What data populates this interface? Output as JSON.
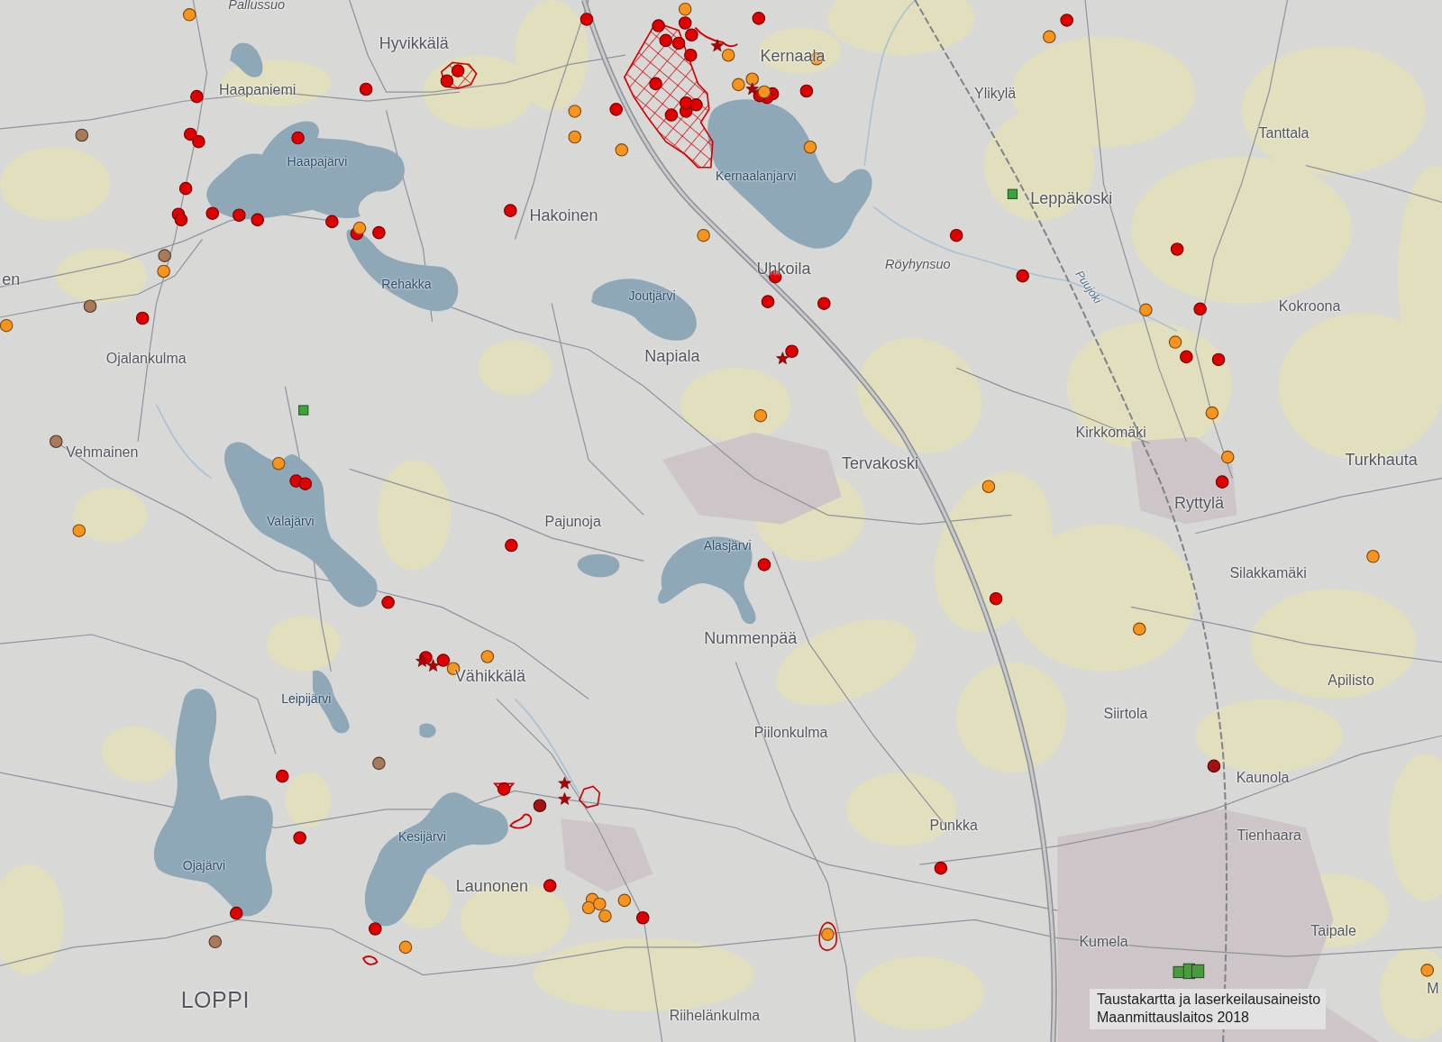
{
  "place_names": [
    {
      "text": "Pallussuo",
      "kind": "swamp"
    },
    {
      "text": "Hyvikkälä",
      "kind": "village"
    },
    {
      "text": "Haapaniemi",
      "kind": "hamlet"
    },
    {
      "text": "Kernaala",
      "kind": "village"
    },
    {
      "text": "Ylikylä",
      "kind": "hamlet"
    },
    {
      "text": "Tanttala",
      "kind": "hamlet"
    },
    {
      "text": "Haapajärvi",
      "kind": "lake"
    },
    {
      "text": "Kernaalanjärvi",
      "kind": "lake"
    },
    {
      "text": "Leppäkoski",
      "kind": "village"
    },
    {
      "text": "Hakoinen",
      "kind": "village"
    },
    {
      "text": "Röyhynsuo",
      "kind": "swamp"
    },
    {
      "text": "Uhkoila",
      "kind": "village"
    },
    {
      "text": "en",
      "kind": "village"
    },
    {
      "text": "Rehakka",
      "kind": "lake"
    },
    {
      "text": "Puujoki",
      "kind": "river"
    },
    {
      "text": "Joutjärvi",
      "kind": "lake"
    },
    {
      "text": "Kokroona",
      "kind": "hamlet"
    },
    {
      "text": "Napiala",
      "kind": "village"
    },
    {
      "text": "Ojalankulma",
      "kind": "hamlet"
    },
    {
      "text": "Kirkkomäki",
      "kind": "hamlet"
    },
    {
      "text": "Vehmainen",
      "kind": "hamlet"
    },
    {
      "text": "Tervakoski",
      "kind": "village"
    },
    {
      "text": "Turkhauta",
      "kind": "village"
    },
    {
      "text": "Ryttylä",
      "kind": "village"
    },
    {
      "text": "Pajunoja",
      "kind": "hamlet"
    },
    {
      "text": "Valajärvi",
      "kind": "lake"
    },
    {
      "text": "Alasjärvi",
      "kind": "lake"
    },
    {
      "text": "Silakkamäki",
      "kind": "hamlet"
    },
    {
      "text": "Nummenpää",
      "kind": "village"
    },
    {
      "text": "Vähikkälä",
      "kind": "village"
    },
    {
      "text": "Apilisto",
      "kind": "hamlet"
    },
    {
      "text": "Leipijärvi",
      "kind": "lake"
    },
    {
      "text": "Siirtola",
      "kind": "hamlet"
    },
    {
      "text": "Piilonkulma",
      "kind": "hamlet"
    },
    {
      "text": "Kaunola",
      "kind": "hamlet"
    },
    {
      "text": "Punkka",
      "kind": "hamlet"
    },
    {
      "text": "Tienhaara",
      "kind": "hamlet"
    },
    {
      "text": "Kesijärvi",
      "kind": "lake"
    },
    {
      "text": "Ojajärvi",
      "kind": "lake"
    },
    {
      "text": "Launonen",
      "kind": "village"
    },
    {
      "text": "Taipale",
      "kind": "hamlet"
    },
    {
      "text": "Kumela",
      "kind": "hamlet"
    },
    {
      "text": "M",
      "kind": "hamlet"
    },
    {
      "text": "LOPPI",
      "kind": "municipality"
    },
    {
      "text": "Riihelänkulma",
      "kind": "hamlet"
    }
  ],
  "markers": [
    {
      "kind": "dot",
      "color": "#e00000"
    },
    {
      "kind": "dot",
      "color": "#e00000"
    },
    {
      "kind": "dot",
      "color": "#e00000"
    },
    {
      "kind": "dot",
      "color": "#e00000"
    },
    {
      "kind": "dot",
      "color": "#e00000"
    },
    {
      "kind": "dot",
      "color": "#e00000"
    },
    {
      "kind": "dot",
      "color": "#e00000"
    },
    {
      "kind": "dot",
      "color": "#e00000"
    },
    {
      "kind": "dot",
      "color": "#e00000"
    },
    {
      "kind": "dot",
      "color": "#e00000"
    },
    {
      "kind": "dot",
      "color": "#e00000"
    },
    {
      "kind": "dot",
      "color": "#e00000"
    },
    {
      "kind": "dot",
      "color": "#e00000"
    },
    {
      "kind": "dot",
      "color": "#e00000"
    },
    {
      "kind": "dot",
      "color": "#e00000"
    },
    {
      "kind": "dot",
      "color": "#e00000"
    },
    {
      "kind": "dot",
      "color": "#e00000"
    },
    {
      "kind": "dot",
      "color": "#e00000"
    },
    {
      "kind": "dot",
      "color": "#e00000"
    },
    {
      "kind": "dot",
      "color": "#e00000"
    },
    {
      "kind": "dot",
      "color": "#e00000"
    },
    {
      "kind": "dot",
      "color": "#e00000"
    },
    {
      "kind": "dot",
      "color": "#e00000"
    },
    {
      "kind": "dot",
      "color": "#e00000"
    },
    {
      "kind": "dot",
      "color": "#e00000"
    },
    {
      "kind": "dot",
      "color": "#e00000"
    },
    {
      "kind": "dot",
      "color": "#e00000"
    },
    {
      "kind": "dot",
      "color": "#e00000"
    },
    {
      "kind": "dot",
      "color": "#e00000"
    },
    {
      "kind": "dot",
      "color": "#e00000"
    },
    {
      "kind": "dot",
      "color": "#e00000"
    },
    {
      "kind": "dot",
      "color": "#e00000"
    },
    {
      "kind": "dot",
      "color": "#e00000"
    },
    {
      "kind": "dot",
      "color": "#e00000"
    },
    {
      "kind": "dot",
      "color": "#e00000"
    },
    {
      "kind": "dot",
      "color": "#e00000"
    },
    {
      "kind": "dot",
      "color": "#e00000"
    },
    {
      "kind": "dot",
      "color": "#e00000"
    },
    {
      "kind": "dot",
      "color": "#e00000"
    },
    {
      "kind": "dot",
      "color": "#e00000"
    },
    {
      "kind": "dot",
      "color": "#e00000"
    },
    {
      "kind": "dot",
      "color": "#e00000"
    },
    {
      "kind": "dot",
      "color": "#e00000"
    },
    {
      "kind": "dot",
      "color": "#e00000"
    },
    {
      "kind": "dot",
      "color": "#e00000"
    },
    {
      "kind": "dot",
      "color": "#e00000"
    },
    {
      "kind": "dot",
      "color": "#e00000"
    },
    {
      "kind": "dot",
      "color": "#e00000"
    },
    {
      "kind": "dot",
      "color": "#e00000"
    },
    {
      "kind": "dot",
      "color": "#e00000"
    },
    {
      "kind": "dot",
      "color": "#e00000"
    },
    {
      "kind": "dot",
      "color": "#e00000"
    },
    {
      "kind": "dot",
      "color": "#e00000"
    },
    {
      "kind": "dot",
      "color": "#e00000"
    },
    {
      "kind": "dot",
      "color": "#e00000"
    },
    {
      "kind": "dot",
      "color": "#e00000"
    },
    {
      "kind": "dot",
      "color": "#e00000"
    },
    {
      "kind": "dot",
      "color": "#e00000"
    },
    {
      "kind": "dot",
      "color": "#e00000"
    },
    {
      "kind": "dot",
      "color": "#e00000"
    },
    {
      "kind": "dot",
      "color": "#e00000"
    },
    {
      "kind": "dot",
      "color": "#e00000"
    },
    {
      "kind": "dot",
      "color": "#e00000"
    },
    {
      "kind": "dot",
      "color": "#e00000"
    },
    {
      "kind": "dot",
      "color": "#a51212"
    },
    {
      "kind": "dot",
      "color": "#a51212"
    },
    {
      "kind": "dot",
      "color": "#f7941d"
    },
    {
      "kind": "dot",
      "color": "#f7941d"
    },
    {
      "kind": "dot",
      "color": "#f7941d"
    },
    {
      "kind": "dot",
      "color": "#f7941d"
    },
    {
      "kind": "dot",
      "color": "#f7941d"
    },
    {
      "kind": "dot",
      "color": "#f7941d"
    },
    {
      "kind": "dot",
      "color": "#f7941d"
    },
    {
      "kind": "dot",
      "color": "#f7941d"
    },
    {
      "kind": "dot",
      "color": "#f7941d"
    },
    {
      "kind": "dot",
      "color": "#f7941d"
    },
    {
      "kind": "dot",
      "color": "#f7941d"
    },
    {
      "kind": "dot",
      "color": "#f7941d"
    },
    {
      "kind": "dot",
      "color": "#f7941d"
    },
    {
      "kind": "dot",
      "color": "#f7941d"
    },
    {
      "kind": "dot",
      "color": "#f7941d"
    },
    {
      "kind": "dot",
      "color": "#f7941d"
    },
    {
      "kind": "dot",
      "color": "#f7941d"
    },
    {
      "kind": "dot",
      "color": "#f7941d"
    },
    {
      "kind": "dot",
      "color": "#f7941d"
    },
    {
      "kind": "dot",
      "color": "#f7941d"
    },
    {
      "kind": "dot",
      "color": "#f7941d"
    },
    {
      "kind": "dot",
      "color": "#f7941d"
    },
    {
      "kind": "dot",
      "color": "#f7941d"
    },
    {
      "kind": "dot",
      "color": "#f7941d"
    },
    {
      "kind": "dot",
      "color": "#f7941d"
    },
    {
      "kind": "dot",
      "color": "#f7941d"
    },
    {
      "kind": "dot",
      "color": "#f7941d"
    },
    {
      "kind": "dot",
      "color": "#f7941d"
    },
    {
      "kind": "dot",
      "color": "#f7941d"
    },
    {
      "kind": "dot",
      "color": "#f7941d"
    },
    {
      "kind": "dot",
      "color": "#f7941d"
    },
    {
      "kind": "dot",
      "color": "#f7941d"
    },
    {
      "kind": "dot",
      "color": "#f7941d"
    },
    {
      "kind": "dot",
      "color": "#f7941d"
    },
    {
      "kind": "dot",
      "color": "#f7941d"
    },
    {
      "kind": "dot",
      "color": "#f7941d"
    },
    {
      "kind": "dot",
      "color": "#a87a5a"
    },
    {
      "kind": "dot",
      "color": "#a87a5a"
    },
    {
      "kind": "dot",
      "color": "#a87a5a"
    },
    {
      "kind": "dot",
      "color": "#a87a5a"
    },
    {
      "kind": "dot",
      "color": "#a87a5a"
    },
    {
      "kind": "dot",
      "color": "#a87a5a"
    },
    {
      "kind": "star",
      "color": "#b30000"
    },
    {
      "kind": "star",
      "color": "#b30000"
    },
    {
      "kind": "star",
      "color": "#b30000"
    },
    {
      "kind": "star",
      "color": "#b30000"
    },
    {
      "kind": "star",
      "color": "#b30000"
    },
    {
      "kind": "star",
      "color": "#b30000"
    },
    {
      "kind": "star",
      "color": "#b30000"
    },
    {
      "kind": "square",
      "color": "#3aa53a"
    },
    {
      "kind": "square",
      "color": "#3aa53a"
    },
    {
      "kind": "cluster",
      "color": "#4a9a40"
    }
  ],
  "attribution": {
    "lines": [
      "Taustakartta ja laserkeilausaineisto",
      "Maanmittauslaitos 2018"
    ]
  }
}
